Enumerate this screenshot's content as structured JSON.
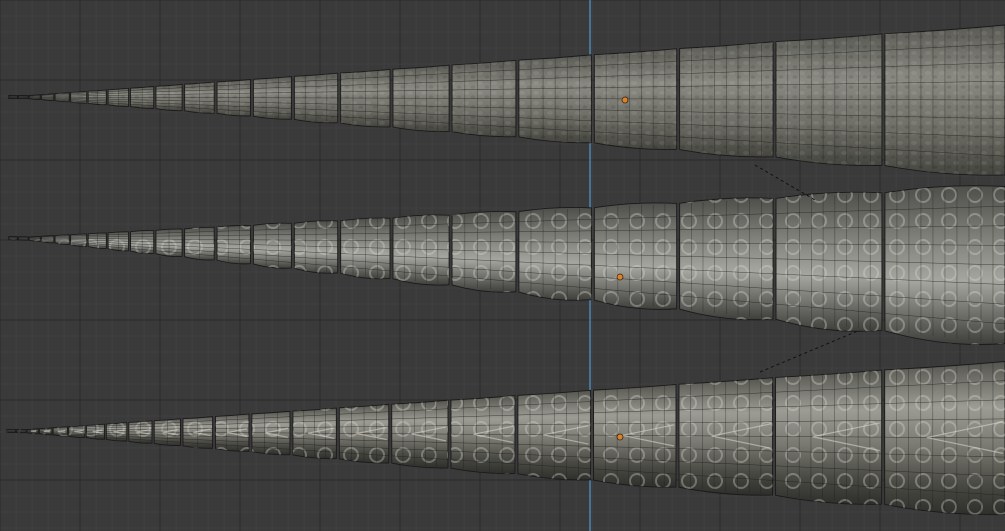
{
  "viewport": {
    "background_color": "#3a3a3a",
    "grid_minor_color": "#434343",
    "grid_major_color": "#2e2e2e",
    "vertical_axis_color": "#4a86b4",
    "origin_marker_color": "#d9822b",
    "wire_color": "#1a1a1a",
    "mesh_base_color": "#6e6e66",
    "mesh_highlight_color": "#9a9a90",
    "mesh_shadow_color": "#3c3c38"
  },
  "objects": [
    {
      "kind": "tapered-tail-mesh",
      "variant": "smooth",
      "segments": 22
    },
    {
      "kind": "tapered-tail-mesh",
      "variant": "ridged",
      "segments": 22
    },
    {
      "kind": "tapered-tail-mesh",
      "variant": "scaled",
      "segments": 22
    }
  ]
}
